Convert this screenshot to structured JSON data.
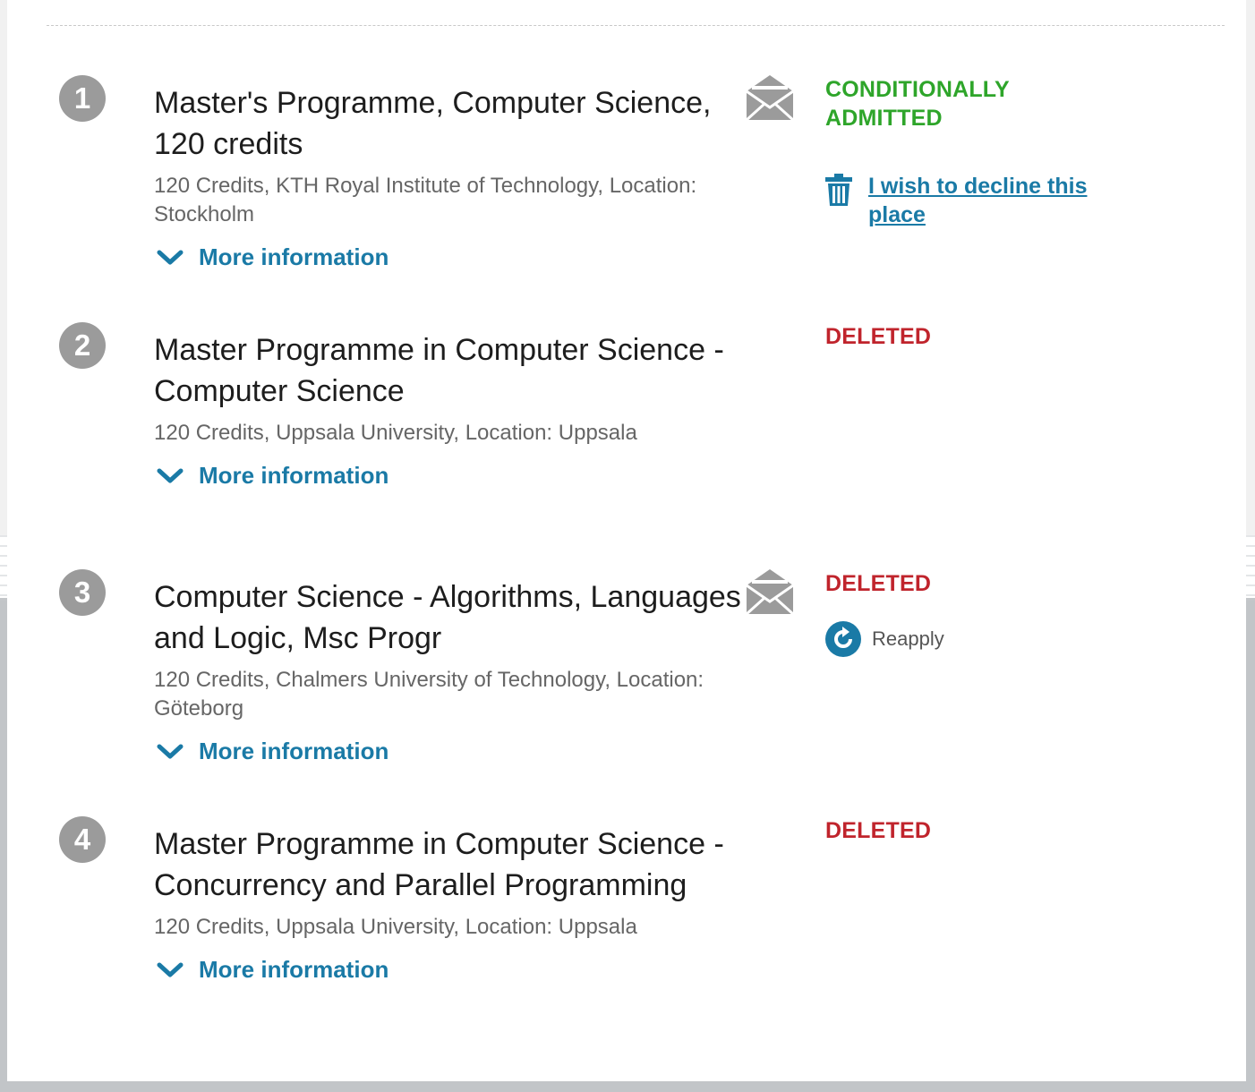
{
  "applications": [
    {
      "rank": "1",
      "title": "Master's Programme, Computer Science, 120 credits",
      "meta": "120 Credits, KTH Royal Institute of Technology, Location: Stockholm",
      "more_info": "More information",
      "status": "CONDITIONALLY ADMITTED",
      "status_color": "#2ea52a",
      "has_mail_icon": true,
      "action": {
        "icon": "trash-icon",
        "label": "I wish to decline this place"
      }
    },
    {
      "rank": "2",
      "title": "Master Programme in Computer Science - Computer Science",
      "meta": "120 Credits, Uppsala University, Location: Uppsala",
      "more_info": "More information",
      "status": "DELETED",
      "status_color": "#c0242c",
      "has_mail_icon": false
    },
    {
      "rank": "3",
      "title": "Computer Science - Algorithms, Languages and Logic, Msc Progr",
      "meta": "120 Credits, Chalmers University of Technology, Location: Göteborg",
      "more_info": "More information",
      "status": "DELETED",
      "status_color": "#c0242c",
      "has_mail_icon": true,
      "action": {
        "icon": "reapply-icon",
        "label": "Reapply"
      }
    },
    {
      "rank": "4",
      "title": "Master Programme in Computer Science - Concurrency and Parallel Programming",
      "meta": "120 Credits, Uppsala University, Location: Uppsala",
      "more_info": "More information",
      "status": "DELETED",
      "status_color": "#c0242c",
      "has_mail_icon": false
    }
  ],
  "colors": {
    "link": "#1a7aa6",
    "badge": "#9b9b9b",
    "meta_text": "#666666"
  }
}
